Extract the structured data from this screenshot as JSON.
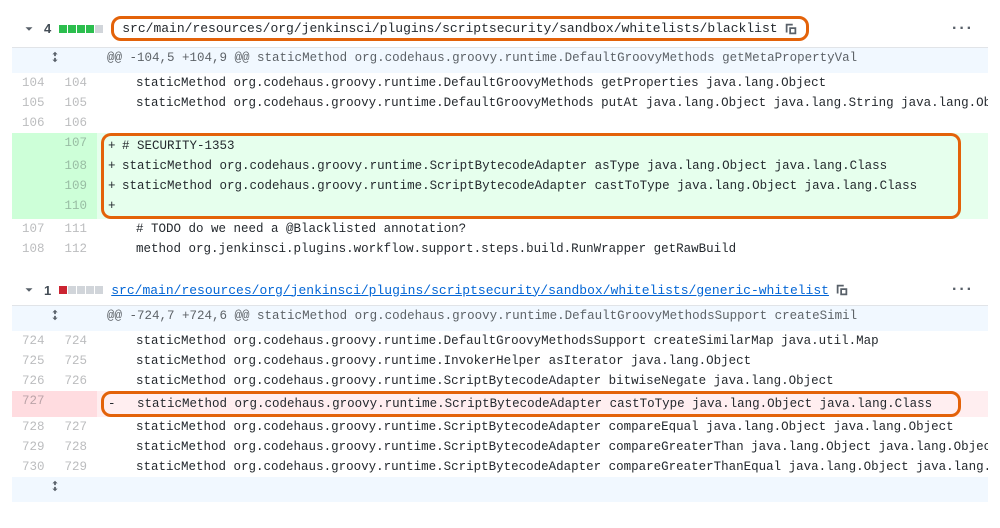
{
  "files": [
    {
      "stat_num": "4",
      "blocks": [
        "add",
        "add",
        "add",
        "add",
        "neutral"
      ],
      "path": "src/main/resources/org/jenkinsci/plugins/scriptsecurity/sandbox/whitelists/blacklist",
      "path_link": false,
      "path_highlight": true,
      "hunk": "@@ -104,5 +104,9 @@ staticMethod org.codehaus.groovy.runtime.DefaultGroovyMethods getMetaPropertyVal",
      "lines": [
        {
          "old": "104",
          "new": "104",
          "type": "ctx",
          "text": "  staticMethod org.codehaus.groovy.runtime.DefaultGroovyMethods getProperties java.lang.Object"
        },
        {
          "old": "105",
          "new": "105",
          "type": "ctx",
          "text": "  staticMethod org.codehaus.groovy.runtime.DefaultGroovyMethods putAt java.lang.Object java.lang.String java.lang.Object"
        },
        {
          "old": "106",
          "new": "106",
          "type": "ctx",
          "text": ""
        },
        {
          "old": "",
          "new": "107",
          "type": "add",
          "text": "# SECURITY-1353",
          "hl": true,
          "hl_pos": "top"
        },
        {
          "old": "",
          "new": "108",
          "type": "add",
          "text": "staticMethod org.codehaus.groovy.runtime.ScriptBytecodeAdapter asType java.lang.Object java.lang.Class",
          "hl": true,
          "hl_pos": "mid"
        },
        {
          "old": "",
          "new": "109",
          "type": "add",
          "text": "staticMethod org.codehaus.groovy.runtime.ScriptBytecodeAdapter castToType java.lang.Object java.lang.Class",
          "hl": true,
          "hl_pos": "mid"
        },
        {
          "old": "",
          "new": "110",
          "type": "add",
          "text": "",
          "hl": true,
          "hl_pos": "bot"
        },
        {
          "old": "107",
          "new": "111",
          "type": "ctx",
          "text": "  # TODO do we need a @Blacklisted annotation?"
        },
        {
          "old": "108",
          "new": "112",
          "type": "ctx",
          "text": "  method org.jenkinsci.plugins.workflow.support.steps.build.RunWrapper getRawBuild"
        }
      ]
    },
    {
      "stat_num": "1",
      "blocks": [
        "del",
        "neutral",
        "neutral",
        "neutral",
        "neutral"
      ],
      "path": "src/main/resources/org/jenkinsci/plugins/scriptsecurity/sandbox/whitelists/generic-whitelist",
      "path_link": true,
      "path_highlight": false,
      "hunk": "@@ -724,7 +724,6 @@ staticMethod org.codehaus.groovy.runtime.DefaultGroovyMethodsSupport createSimil",
      "lines": [
        {
          "old": "724",
          "new": "724",
          "type": "ctx",
          "text": "  staticMethod org.codehaus.groovy.runtime.DefaultGroovyMethodsSupport createSimilarMap java.util.Map"
        },
        {
          "old": "725",
          "new": "725",
          "type": "ctx",
          "text": "  staticMethod org.codehaus.groovy.runtime.InvokerHelper asIterator java.lang.Object"
        },
        {
          "old": "726",
          "new": "726",
          "type": "ctx",
          "text": "  staticMethod org.codehaus.groovy.runtime.ScriptBytecodeAdapter bitwiseNegate java.lang.Object"
        },
        {
          "old": "727",
          "new": "",
          "type": "del",
          "text": "  staticMethod org.codehaus.groovy.runtime.ScriptBytecodeAdapter castToType java.lang.Object java.lang.Class",
          "hl": true,
          "hl_pos": "single"
        },
        {
          "old": "728",
          "new": "727",
          "type": "ctx",
          "text": "  staticMethod org.codehaus.groovy.runtime.ScriptBytecodeAdapter compareEqual java.lang.Object java.lang.Object"
        },
        {
          "old": "729",
          "new": "728",
          "type": "ctx",
          "text": "  staticMethod org.codehaus.groovy.runtime.ScriptBytecodeAdapter compareGreaterThan java.lang.Object java.lang.Object"
        },
        {
          "old": "730",
          "new": "729",
          "type": "ctx",
          "text": "  staticMethod org.codehaus.groovy.runtime.ScriptBytecodeAdapter compareGreaterThanEqual java.lang.Object java.lang.Obje"
        }
      ],
      "trailing_expand": true
    }
  ]
}
